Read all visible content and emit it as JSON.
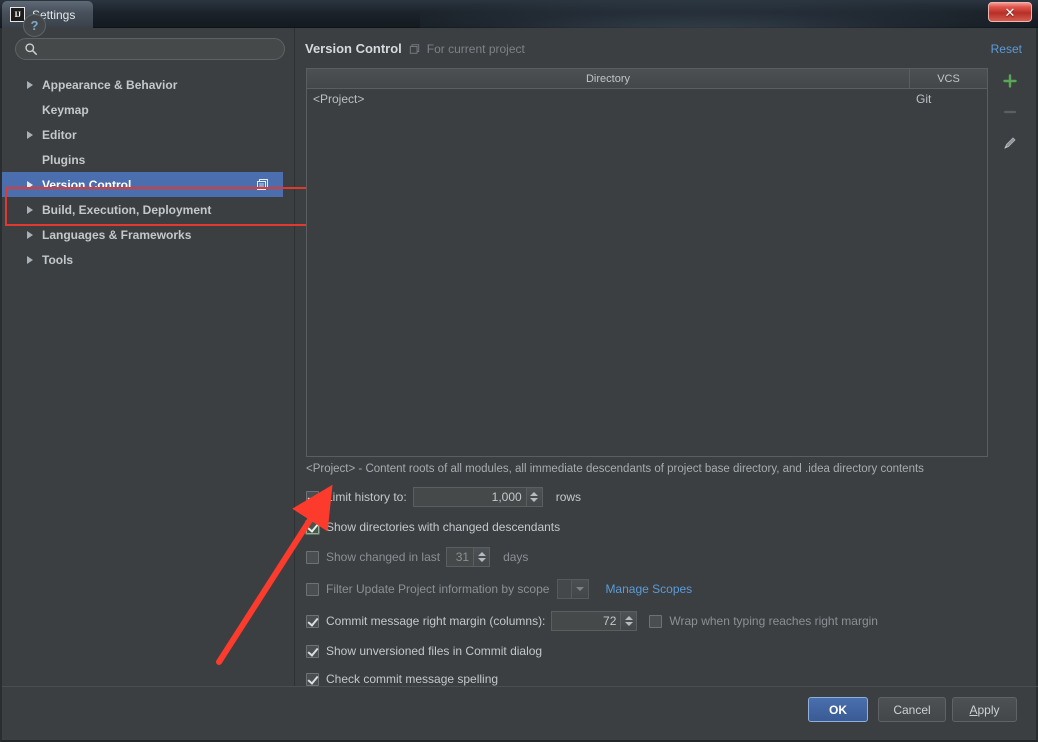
{
  "window": {
    "title": "Settings",
    "logo_text": "IJ",
    "close_label": "✕"
  },
  "sidebar": {
    "search": {
      "value": "",
      "placeholder": ""
    },
    "items": [
      {
        "label": "Appearance & Behavior",
        "expandable": true,
        "selected": false
      },
      {
        "label": "Keymap",
        "expandable": false,
        "selected": false
      },
      {
        "label": "Editor",
        "expandable": true,
        "selected": false
      },
      {
        "label": "Plugins",
        "expandable": false,
        "selected": false
      },
      {
        "label": "Version Control",
        "expandable": true,
        "selected": true
      },
      {
        "label": "Build, Execution, Deployment",
        "expandable": true,
        "selected": false
      },
      {
        "label": "Languages & Frameworks",
        "expandable": true,
        "selected": false
      },
      {
        "label": "Tools",
        "expandable": true,
        "selected": false
      }
    ]
  },
  "panel": {
    "title": "Version Control",
    "scope_note": "For current project",
    "reset_label": "Reset",
    "table": {
      "columns": [
        "Directory",
        "VCS"
      ],
      "rows": [
        {
          "directory": "<Project>",
          "vcs": "Git"
        }
      ]
    },
    "tools": [
      {
        "name": "add-icon",
        "glyph": "+"
      },
      {
        "name": "remove-icon",
        "glyph": "−"
      },
      {
        "name": "edit-icon",
        "glyph": "✎"
      }
    ],
    "hint": "<Project> - Content roots of all modules, all immediate descendants of project base directory, and .idea directory contents",
    "options": {
      "limit_history": {
        "label": "Limit history to:",
        "checked": true,
        "value": "1,000",
        "suffix": "rows"
      },
      "show_directories": {
        "label": "Show directories with changed descendants",
        "checked": true,
        "focused": true
      },
      "show_changed_last": {
        "label": "Show changed in last",
        "checked": false,
        "value": "31",
        "suffix": "days"
      },
      "filter_by_scope": {
        "label": "Filter Update Project information by scope",
        "checked": false,
        "scope_value": "",
        "link_label": "Manage Scopes"
      },
      "commit_margin": {
        "label": "Commit message right margin (columns):",
        "checked": true,
        "value": "72",
        "wrap_label": "Wrap when typing reaches right margin",
        "wrap_checked": false
      },
      "show_unversioned": {
        "label": "Show unversioned files in Commit dialog",
        "checked": true
      },
      "check_spelling": {
        "label": "Check commit message spelling",
        "checked": true
      }
    }
  },
  "footer": {
    "help_label": "?",
    "ok_label": "OK",
    "cancel_label": "Cancel",
    "apply_label_prefix": "A",
    "apply_label_rest": "pply"
  },
  "annotation": {
    "highlight_color": "#e03a30",
    "arrow_color": "#fc3b2d"
  }
}
